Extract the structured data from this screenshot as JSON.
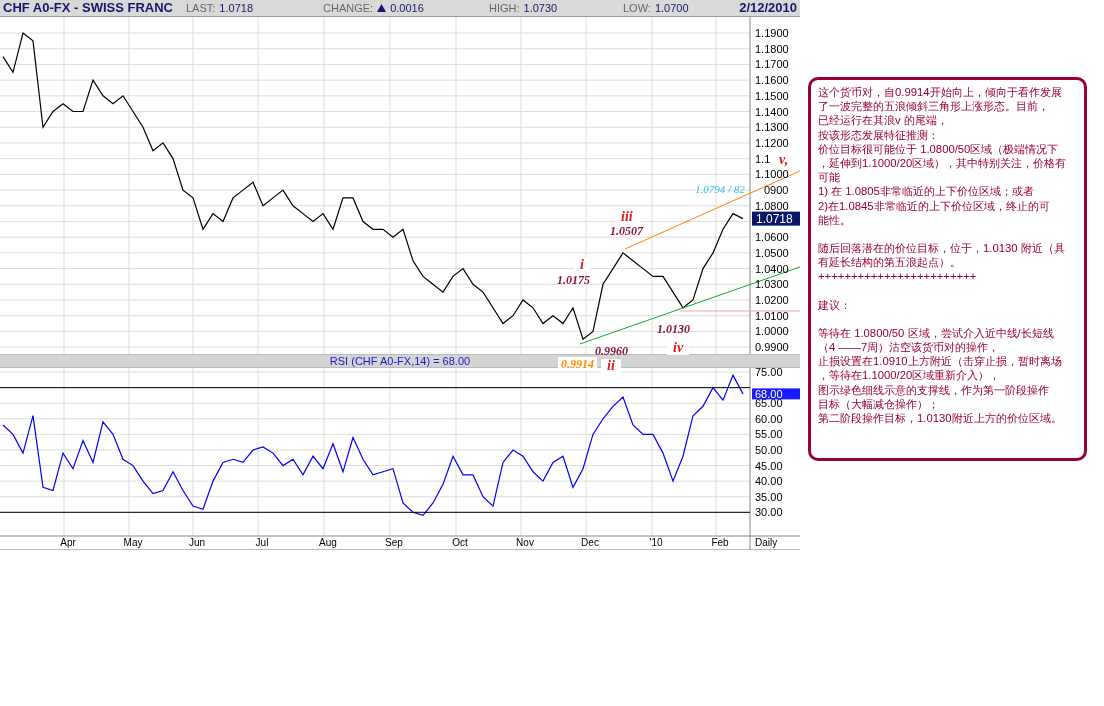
{
  "header": {
    "symbol": "CHF A0-FX - SWISS FRANC",
    "fields": [
      {
        "label": "LAST:",
        "value": "1.0718"
      },
      {
        "label": "CHANGE:",
        "value": "0.0016",
        "rising": true
      },
      {
        "label": "HIGH:",
        "value": "1.0730"
      },
      {
        "label": "LOW:",
        "value": "1.0700"
      }
    ],
    "date": "2/12/2010"
  },
  "price_chart": {
    "last_price": "1.0718",
    "partial_axis_labels": [
      "1.1",
      "0900"
    ],
    "annotations": [
      {
        "kind": "wave",
        "text": "v,"
      },
      {
        "kind": "target",
        "text": "1.0794 / 82"
      },
      {
        "kind": "wave",
        "text": "iii"
      },
      {
        "kind": "price",
        "text": "1.0507"
      },
      {
        "kind": "wave",
        "text": "i"
      },
      {
        "kind": "price",
        "text": "1.0175"
      },
      {
        "kind": "price",
        "text": "1.0130"
      },
      {
        "kind": "price",
        "text": "0.9960"
      },
      {
        "kind": "wave",
        "text": "iv"
      },
      {
        "kind": "start",
        "text": "0.9914"
      },
      {
        "kind": "wave",
        "text": "ii"
      }
    ],
    "chart_data": {
      "type": "line",
      "grid": true,
      "ylim": [
        0.9856,
        1.2002
      ],
      "series": [
        {
          "color": "#000000",
          "values": [
            1.175,
            1.165,
            1.19,
            1.185,
            1.13,
            1.14,
            1.145,
            1.14,
            1.14,
            1.16,
            1.15,
            1.145,
            1.15,
            1.14,
            1.13,
            1.115,
            1.12,
            1.11,
            1.09,
            1.085,
            1.065,
            1.075,
            1.07,
            1.085,
            1.09,
            1.095,
            1.08,
            1.085,
            1.09,
            1.08,
            1.075,
            1.07,
            1.075,
            1.065,
            1.085,
            1.085,
            1.07,
            1.065,
            1.065,
            1.06,
            1.065,
            1.045,
            1.035,
            1.03,
            1.025,
            1.035,
            1.04,
            1.03,
            1.025,
            1.015,
            1.005,
            1.01,
            1.02,
            1.015,
            1.005,
            1.01,
            1.005,
            1.015,
            0.995,
            1.0,
            1.03,
            1.04,
            1.05,
            1.045,
            1.04,
            1.035,
            1.035,
            1.025,
            1.015,
            1.02,
            1.04,
            1.05,
            1.065,
            1.075,
            1.0718
          ]
        }
      ],
      "yticks": [
        {
          "value": 1.19,
          "label": "1.1900"
        },
        {
          "value": 1.18,
          "label": "1.1800"
        },
        {
          "value": 1.17,
          "label": "1.1700"
        },
        {
          "value": 1.16,
          "label": "1.1600"
        },
        {
          "value": 1.15,
          "label": "1.1500"
        },
        {
          "value": 1.14,
          "label": "1.1400"
        },
        {
          "value": 1.13,
          "label": "1.1300"
        },
        {
          "value": 1.12,
          "label": "1.1200"
        },
        {
          "value": 1.1,
          "label": "1.1000"
        },
        {
          "value": 1.08,
          "label": "1.0800"
        },
        {
          "value": 1.06,
          "label": "1.0600"
        },
        {
          "value": 1.05,
          "label": "1.0500"
        },
        {
          "value": 1.04,
          "label": "1.0400"
        },
        {
          "value": 1.03,
          "label": "1.0300"
        },
        {
          "value": 1.02,
          "label": "1.0200"
        },
        {
          "value": 1.01,
          "label": "1.0100"
        },
        {
          "value": 1.0,
          "label": "1.0000"
        },
        {
          "value": 0.99,
          "label": "0.9900"
        }
      ]
    }
  },
  "rsi_chart": {
    "title": "RSI (CHF A0-FX,14) = 68.00",
    "last_value": "68.00",
    "period": "Daily",
    "months": [
      "Apr",
      "May",
      "Jun",
      "Jul",
      "Aug",
      "Sep",
      "Oct",
      "Nov",
      "Dec",
      "'10",
      "Feb"
    ],
    "chart_data": {
      "type": "line",
      "grid": true,
      "ylim": [
        22.4,
        76.3
      ],
      "series": [
        {
          "color": "#0000ff",
          "values": [
            58,
            55,
            49,
            61,
            38,
            37,
            49,
            44,
            53,
            46,
            59,
            55,
            47,
            45,
            40,
            36,
            37,
            43,
            37,
            32,
            31,
            40,
            46,
            47,
            46,
            50,
            51,
            49,
            45,
            47,
            42,
            48,
            44,
            52,
            43,
            54,
            47,
            42,
            43,
            44,
            33,
            30,
            29,
            33,
            39,
            48,
            42,
            42,
            35,
            32,
            46,
            50,
            48,
            43,
            40,
            46,
            48,
            38,
            44,
            55,
            60,
            64,
            67,
            58,
            55,
            55,
            49,
            40,
            48,
            61,
            64,
            70,
            66,
            74,
            68
          ]
        }
      ],
      "yticks": [
        {
          "value": 75,
          "label": "75.00"
        },
        {
          "value": 65,
          "label": "65.00"
        },
        {
          "value": 60,
          "label": "60.00"
        },
        {
          "value": 55,
          "label": "55.00"
        },
        {
          "value": 50,
          "label": "50.00"
        },
        {
          "value": 45,
          "label": "45.00"
        },
        {
          "value": 40,
          "label": "40.00"
        },
        {
          "value": 35,
          "label": "35.00"
        },
        {
          "value": 30,
          "label": "30.00"
        }
      ]
    }
  },
  "note": {
    "paragraphs": [
      [
        "这个货币对，自0.9914开始向上，倾向于看作发展",
        "了一波完整的五浪倾斜三角形上涨形态。目前，",
        "已经运行在其浪v 的尾端，",
        "按该形态发展特征推测：",
        "价位目标很可能位于 1.0800/50区域（极端情况下",
        "，延伸到1.1000/20区域），其中特别关注，价格有",
        "可能",
        "1) 在 1.0805非常临近的上下价位区域；或者",
        "2)在1.0845非常临近的上下价位区域，终止的可",
        "能性。"
      ],
      [
        "随后回落潜在的价位目标，位于，1.0130 附近（具",
        "有延长结构的第五浪起点）。",
        "++++++++++++++++++++++++"
      ],
      [
        "建议："
      ],
      [
        "等待在 1.0800/50 区域，尝试介入近中线/长短线",
        "（4 ——7周）沽空该货币对的操作，",
        "止损设置在1.0910上方附近（击穿止损，暂时离场",
        "，等待在1.1000/20区域重新介入），",
        "图示绿色细线示意的支撑线，作为第一阶段操作",
        "目标（大幅减仓操作）；",
        "第二阶段操作目标，1.0130附近上方的价位区域。"
      ]
    ]
  }
}
